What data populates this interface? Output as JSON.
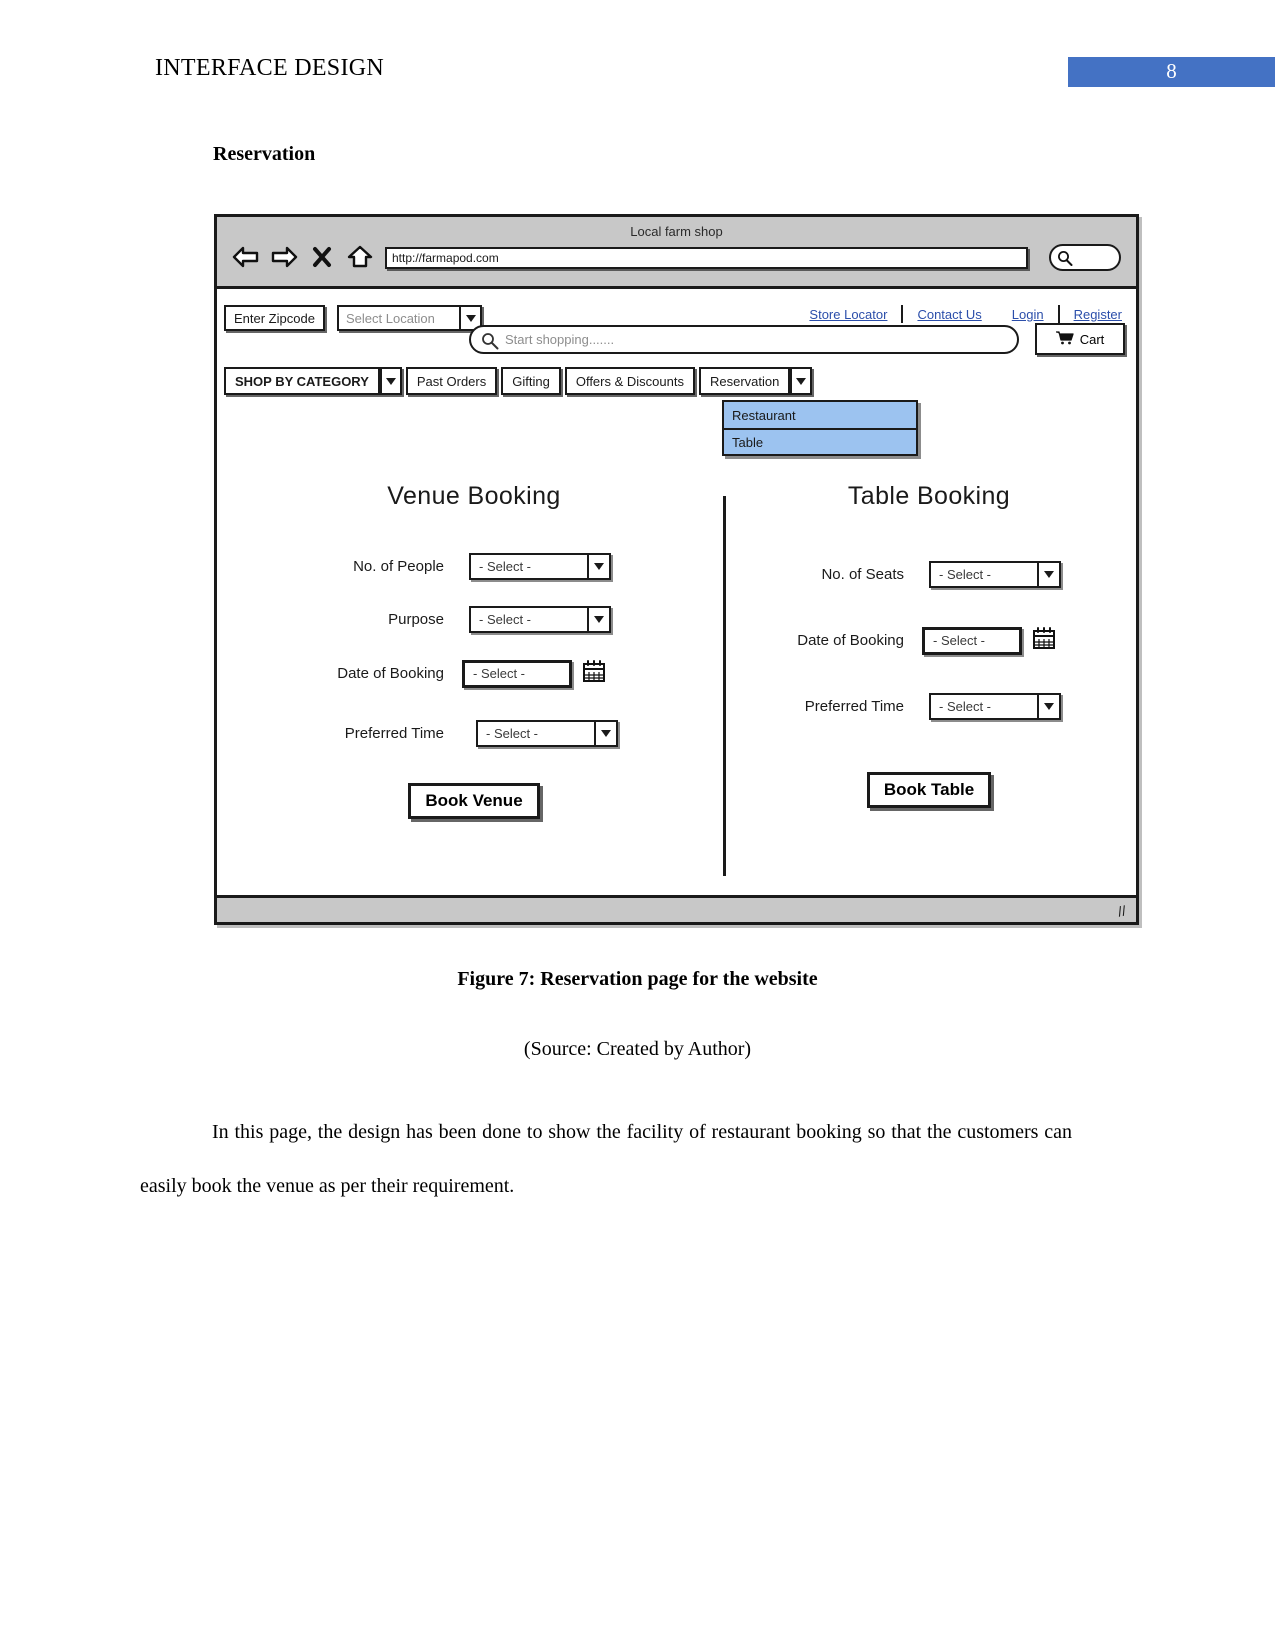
{
  "document": {
    "header_title": "INTERFACE DESIGN",
    "page_number": "8",
    "accent_color": "#4472c4",
    "section_heading": "Reservation",
    "figure_caption": "Figure 7: Reservation page for the website",
    "source_caption": "(Source: Created by Author)",
    "body_paragraph": "In this page, the design has been done to show the facility of restaurant booking so that the customers can easily book the venue as per their requirement."
  },
  "mockup": {
    "browser": {
      "title": "Local farm shop",
      "url": "http://farmapod.com",
      "icons": [
        "back-arrow-icon",
        "forward-arrow-icon",
        "close-icon",
        "home-icon"
      ],
      "search_icon": "search-icon"
    },
    "utility_bar": {
      "zipcode_label": "Enter Zipcode",
      "location_placeholder": "Select Location",
      "links": [
        {
          "label": "Store Locator"
        },
        {
          "label": "Contact Us"
        },
        {
          "label": "Login"
        },
        {
          "label": "Register"
        }
      ],
      "link_color": "#2b4eaa"
    },
    "shopping_search": {
      "placeholder": "Start shopping.......",
      "icon": "search-icon"
    },
    "cart": {
      "label": "Cart",
      "icon": "shopping-cart-icon"
    },
    "menu": {
      "category_label": "SHOP BY CATEGORY",
      "items": [
        {
          "label": "Past Orders"
        },
        {
          "label": "Gifting"
        },
        {
          "label": "Offers & Discounts"
        }
      ],
      "reservation_label": "Reservation",
      "dropdown": {
        "highlight_color": "#9cc3f0",
        "options": [
          {
            "label": "Restaurant"
          },
          {
            "label": "Table"
          }
        ]
      }
    },
    "venue_booking": {
      "title": "Venue Booking",
      "fields": [
        {
          "label": "No. of People",
          "value": "- Select -",
          "control": "select"
        },
        {
          "label": "Purpose",
          "value": "- Select -",
          "control": "select"
        },
        {
          "label": "Date of Booking",
          "value": "- Select -",
          "control": "date"
        },
        {
          "label": "Preferred Time",
          "value": "- Select -",
          "control": "select"
        }
      ],
      "submit_label": "Book Venue"
    },
    "table_booking": {
      "title": "Table Booking",
      "fields": [
        {
          "label": "No. of Seats",
          "value": "- Select -",
          "control": "select"
        },
        {
          "label": "Date of Booking",
          "value": "- Select -",
          "control": "date"
        },
        {
          "label": "Preferred Time",
          "value": "- Select -",
          "control": "select"
        }
      ],
      "submit_label": "Book Table"
    }
  }
}
